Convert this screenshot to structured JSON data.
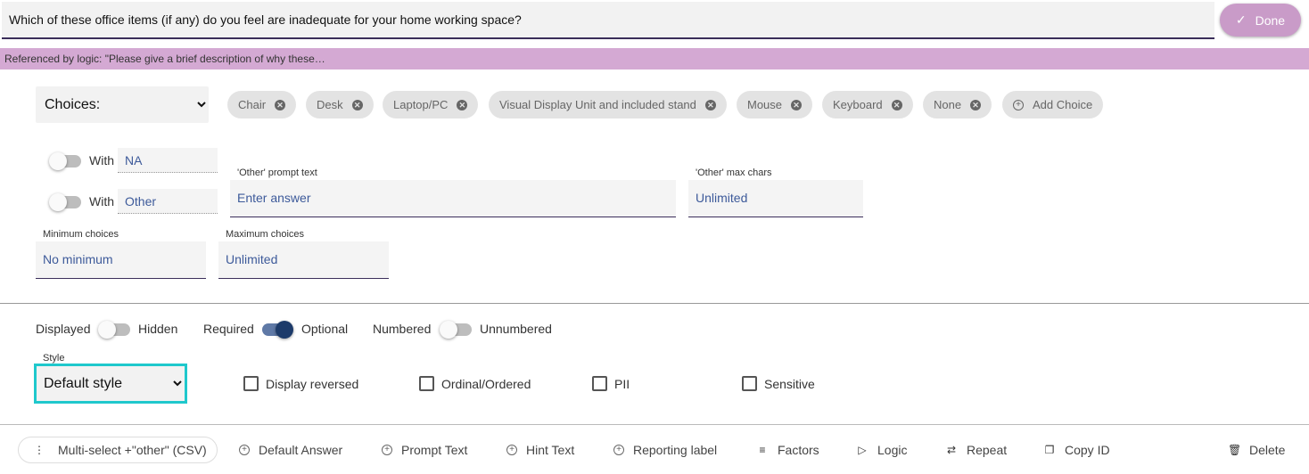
{
  "question": {
    "text": "Which of these office items (if any) do you feel are inadequate for your home working space?",
    "done_label": "Done"
  },
  "logic_banner": "Referenced by logic: \"Please give a brief description of why these…",
  "choices": {
    "type_selected": "Choices:",
    "items": [
      "Chair",
      "Desk",
      "Laptop/PC",
      "Visual Display Unit and included stand",
      "Mouse",
      "Keyboard",
      "None"
    ],
    "add_label": "Add Choice"
  },
  "with_na": {
    "label": "With",
    "value": "NA"
  },
  "with_other": {
    "label": "With",
    "value": "Other"
  },
  "other_prompt": {
    "label": "'Other' prompt text",
    "placeholder": "Enter answer"
  },
  "other_max": {
    "label": "'Other' max chars",
    "value": "Unlimited"
  },
  "min_choices": {
    "label": "Minimum choices",
    "value": "No minimum"
  },
  "max_choices": {
    "label": "Maximum choices",
    "value": "Unlimited"
  },
  "visibility": {
    "left": "Displayed",
    "right": "Hidden",
    "on": false
  },
  "required": {
    "left": "Required",
    "right": "Optional",
    "on": true
  },
  "numbered": {
    "left": "Numbered",
    "right": "Unnumbered",
    "on": false
  },
  "style": {
    "label": "Style",
    "selected": "Default style"
  },
  "options": {
    "display_reversed": "Display reversed",
    "ordinal": "Ordinal/Ordered",
    "pii": "PII",
    "sensitive": "Sensitive"
  },
  "toolbar": {
    "type": "Multi-select +\"other\" (CSV)",
    "default_answer": "Default Answer",
    "prompt_text": "Prompt Text",
    "hint_text": "Hint Text",
    "reporting_label": "Reporting label",
    "factors": "Factors",
    "logic": "Logic",
    "repeat": "Repeat",
    "copy_id": "Copy ID",
    "delete": "Delete"
  },
  "colors": {
    "accent": "#c99bc8",
    "banner": "#d4a9d3",
    "focus": "#1fc8cc",
    "toggle_on": "#1d3b6a"
  }
}
